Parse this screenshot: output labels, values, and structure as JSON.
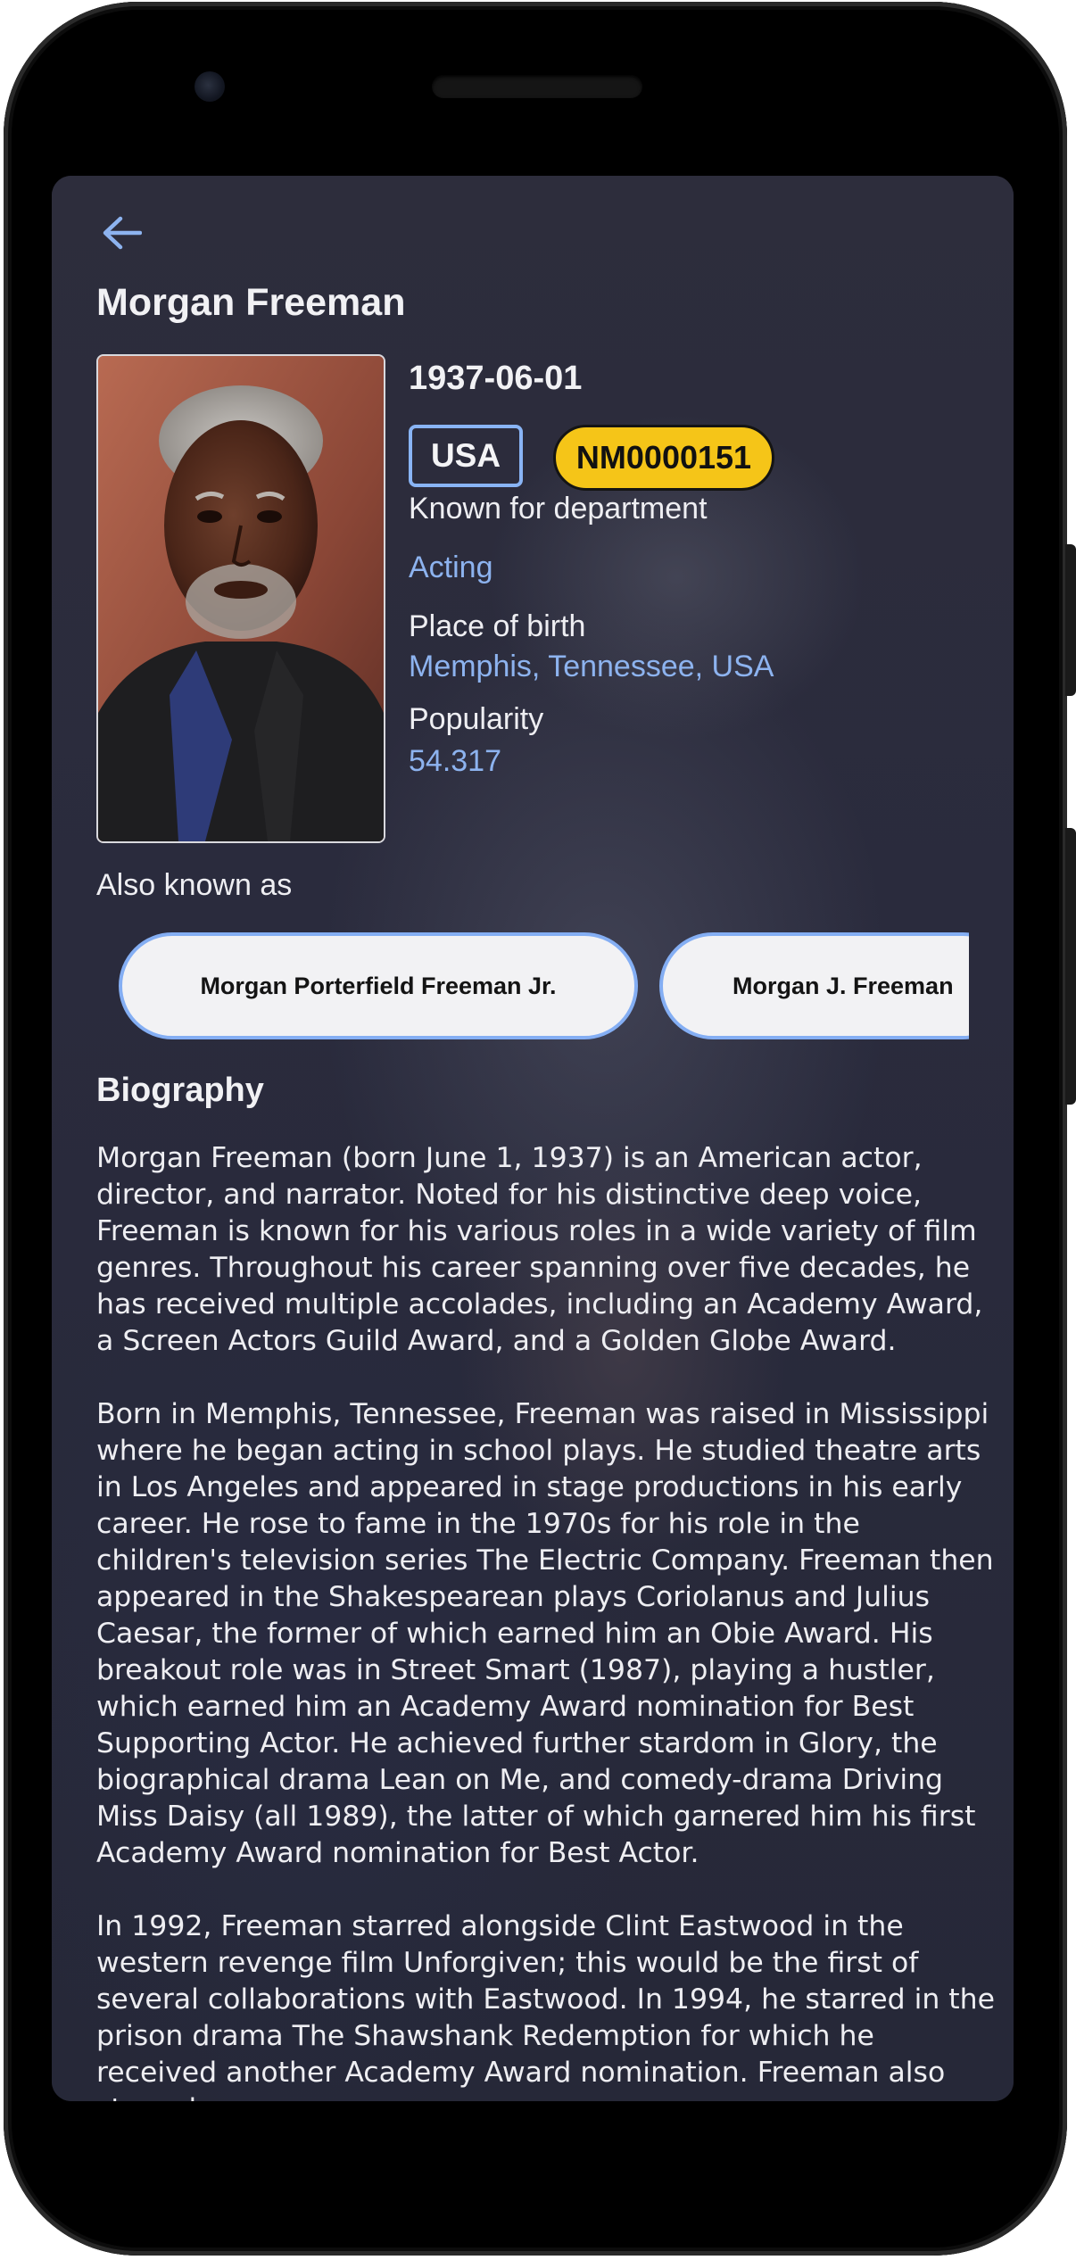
{
  "person": {
    "name": "Morgan Freeman",
    "birthday": "1937-06-01",
    "country": "USA",
    "imdb_id": "NM0000151"
  },
  "details": {
    "department_label": "Known for department",
    "department_value": "Acting",
    "birthplace_label": "Place of birth",
    "birthplace_value": "Memphis, Tennessee, USA",
    "popularity_label": "Popularity",
    "popularity_value": "54.317"
  },
  "aka": {
    "label": "Also known as",
    "names": [
      "Morgan Porterfield Freeman Jr.",
      "Morgan J. Freeman"
    ]
  },
  "biography": {
    "title": "Biography",
    "paragraphs": [
      "Morgan Freeman (born June 1, 1937) is an American actor, director, and narrator. Noted for his distinctive deep voice, Freeman is known for his various roles in a wide variety of film genres. Throughout his career spanning over five decades, he has received multiple accolades, including an Academy Award, a Screen Actors Guild Award, and a Golden Globe Award.",
      "Born in Memphis, Tennessee, Freeman was raised in Mississippi where he began acting in school plays. He studied theatre arts in Los Angeles and appeared in stage productions in his early career. He rose to fame in the 1970s for his role in the children's television series The Electric Company. Freeman then appeared in the Shakespearean plays Coriolanus and Julius Caesar, the former of which earned him an Obie Award. His breakout role was in Street Smart (1987), playing a hustler, which earned him an Academy Award nomination for Best Supporting Actor. He achieved further stardom in Glory, the biographical drama Lean on Me, and comedy-drama Driving Miss Daisy (all 1989), the latter of which garnered him his first Academy Award nomination for Best Actor.",
      "In 1992, Freeman starred alongside Clint Eastwood in the western revenge film Unforgiven; this would be the first of several collaborations with Eastwood. In 1994, he starred in the prison drama The Shawshank Redemption for which he received another Academy Award nomination. Freeman also starred"
    ]
  },
  "icons": {
    "back": "arrow-left-icon"
  },
  "colors": {
    "accent": "#8db3ef",
    "imdb": "#f5c518",
    "background": "#2b2b3b"
  }
}
